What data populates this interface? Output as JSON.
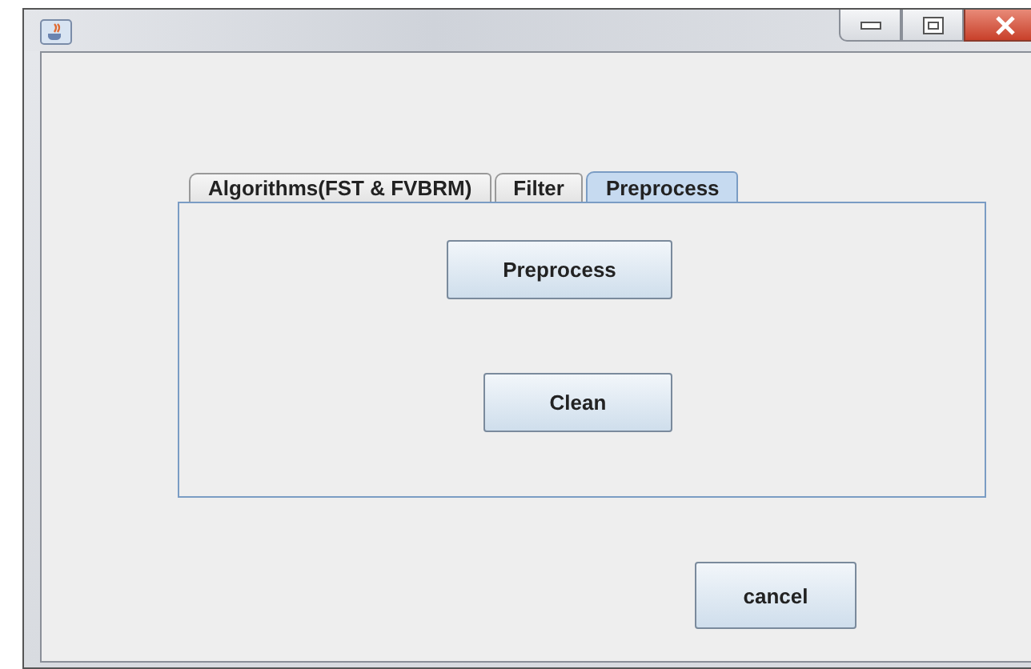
{
  "tabs": [
    {
      "label": "Algorithms(FST & FVBRM)",
      "selected": false
    },
    {
      "label": "Filter",
      "selected": false
    },
    {
      "label": "Preprocess",
      "selected": true
    }
  ],
  "panel_buttons": [
    "Preprocess",
    "Clean"
  ],
  "cancel_button": "cancel"
}
